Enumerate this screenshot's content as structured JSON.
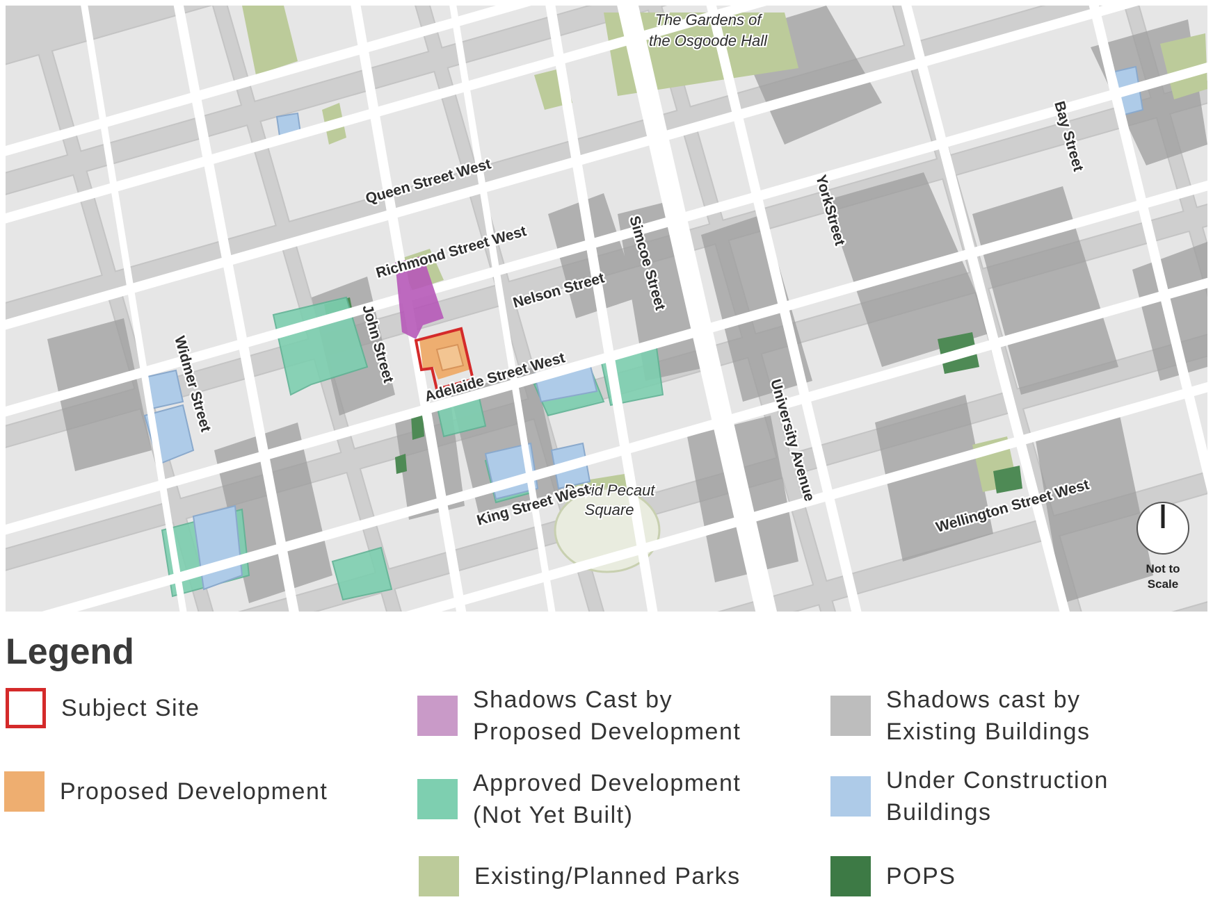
{
  "map": {
    "park_labels": {
      "osgoode_line1": "The Gardens of",
      "osgoode_line2": "the Osgoode Hall",
      "pecaut_line1": "David Pecaut",
      "pecaut_line2": "Square"
    },
    "street_labels": {
      "queen": "Queen Street West",
      "richmond": "Richmond Street West",
      "nelson": "Nelson Street",
      "adelaide": "Adelaide Street West",
      "king": "King Street West",
      "wellington": "Wellington Street West",
      "john": "John Street",
      "widmer": "Widmer Street",
      "simcoe": "Simcoe Street",
      "university": "University Avenue",
      "york": "YorkStreet",
      "bay": "Bay Street"
    },
    "north_arrow": {
      "line1": "Not to",
      "line2": "Scale"
    }
  },
  "legend": {
    "title": "Legend",
    "items": {
      "subject_site": "Subject Site",
      "proposed_development": "Proposed Development",
      "shadows_proposed": "Shadows Cast by\nProposed Development",
      "approved_development": "Approved Development\n(Not Yet Built)",
      "parks": "Existing/Planned Parks",
      "shadows_existing": "Shadows cast by\nExisting Buildings",
      "under_construction": "Under Construction\nBuildings",
      "pops": "POPS"
    }
  },
  "colors": {
    "subject_site_outline": "#d42a2a",
    "proposed_development": "#eeae70",
    "shadows_proposed": "#c99ac8",
    "approved_development": "#7ecfb0",
    "parks": "#bccb9a",
    "shadows_existing": "#bdbdbd",
    "under_construction": "#aecbe8",
    "pops": "#3d7a45"
  }
}
